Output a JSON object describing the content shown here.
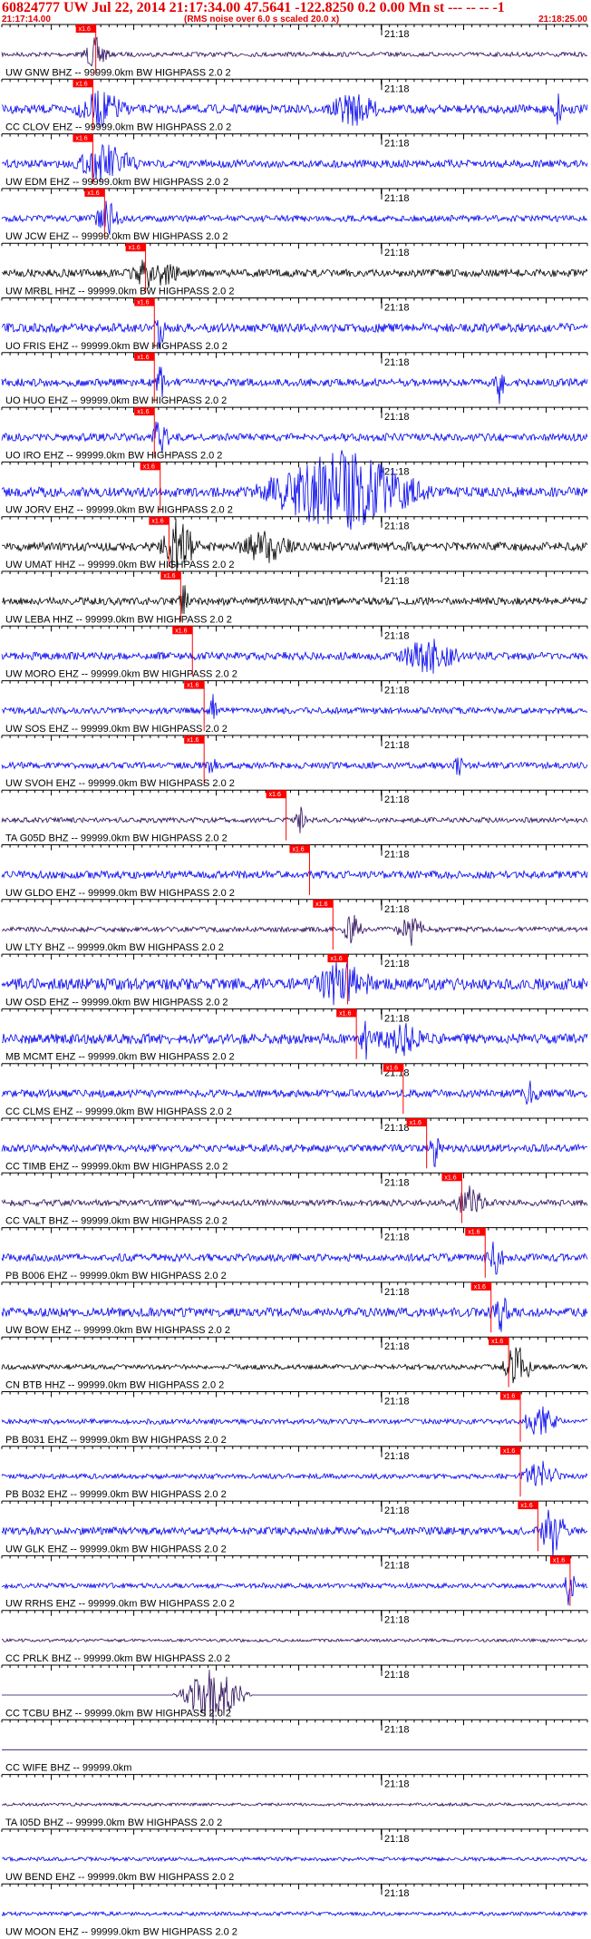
{
  "header": {
    "title": "60824777 UW Jul 22, 2014 21:17:34.00   47.5641 -122.8250  0.2 0.00 Mn st --- -- --  -1",
    "start_time": "21:17:14.00",
    "note": "(RMS noise over 6.0 s scaled 20.0 x)",
    "end_time": "21:18:25.00"
  },
  "minute_label": "21:18",
  "pick_label": "x1.6",
  "colors": {
    "blue": "#0000ee",
    "black": "#000000",
    "purple": "#2a0a5a",
    "pick": "#ff0000",
    "axis": "#000000"
  },
  "traces": [
    {
      "label": "UW GNW BHZ -- 99999.0km BW  HIGHPASS  2.0  2",
      "color": "purple",
      "amp": 0.18,
      "pick": 0.145,
      "bursts": [
        [
          0.16,
          0.025,
          0.9
        ]
      ]
    },
    {
      "label": "CC CLOV EHZ -- 99999.0km BW  HIGHPASS  2.0  2",
      "color": "blue",
      "amp": 0.35,
      "pick": 0.14,
      "bursts": [
        [
          0.17,
          0.05,
          0.9
        ],
        [
          0.6,
          0.05,
          0.8
        ],
        [
          0.95,
          0.01,
          1
        ]
      ]
    },
    {
      "label": "UW EDM EHZ -- 99999.0km BW  HIGHPASS  2.0  2",
      "color": "blue",
      "amp": 0.3,
      "pick": 0.14,
      "bursts": [
        [
          0.18,
          0.06,
          1
        ]
      ]
    },
    {
      "label": "UW JCW EHZ -- 99999.0km BW  HIGHPASS  2.0  2",
      "color": "blue",
      "amp": 0.25,
      "pick": 0.16,
      "bursts": [
        [
          0.18,
          0.03,
          0.9
        ]
      ]
    },
    {
      "label": "UW MRBL HHZ -- 99999.0km BW  HIGHPASS  2.0  2",
      "color": "black",
      "amp": 0.3,
      "pick": 0.23,
      "bursts": [
        [
          0.26,
          0.05,
          0.9
        ]
      ]
    },
    {
      "label": "UO FRIS EHZ -- 99999.0km BW  HIGHPASS  2.0  2",
      "color": "blue",
      "amp": 0.35,
      "pick": 0.245,
      "bursts": [
        [
          0.27,
          0.01,
          1
        ]
      ]
    },
    {
      "label": "UO HUO EHZ -- 99999.0km BW  HIGHPASS  2.0  2",
      "color": "blue",
      "amp": 0.3,
      "pick": 0.245,
      "bursts": [
        [
          0.27,
          0.01,
          1
        ],
        [
          0.85,
          0.01,
          1
        ]
      ]
    },
    {
      "label": "UO IRO EHZ -- 99999.0km BW  HIGHPASS  2.0  2",
      "color": "blue",
      "amp": 0.3,
      "pick": 0.245,
      "bursts": [
        [
          0.27,
          0.02,
          1
        ]
      ]
    },
    {
      "label": "UW JORV EHZ -- 99999.0km BW  HIGHPASS  2.0  2",
      "color": "blue",
      "amp": 0.4,
      "pick": 0.255,
      "bursts": [
        [
          0.58,
          0.16,
          2.2
        ]
      ]
    },
    {
      "label": "UW UMAT HHZ -- 99999.0km BW  HIGHPASS  2.0  2",
      "color": "black",
      "amp": 0.35,
      "pick": 0.27,
      "bursts": [
        [
          0.3,
          0.04,
          1.4
        ],
        [
          0.45,
          0.05,
          0.9
        ]
      ]
    },
    {
      "label": "UW LEBA HHZ -- 99999.0km BW  HIGHPASS  2.0  2",
      "color": "black",
      "amp": 0.3,
      "pick": 0.29,
      "bursts": [
        [
          0.31,
          0.01,
          1
        ]
      ]
    },
    {
      "label": "UW MORO EHZ -- 99999.0km BW  HIGHPASS  2.0  2",
      "color": "blue",
      "amp": 0.3,
      "pick": 0.31,
      "bursts": [
        [
          0.73,
          0.06,
          0.9
        ]
      ]
    },
    {
      "label": "UW SOS EHZ -- 99999.0km BW  HIGHPASS  2.0  2",
      "color": "blue",
      "amp": 0.25,
      "pick": 0.33,
      "bursts": [
        [
          0.36,
          0.01,
          0.8
        ]
      ]
    },
    {
      "label": "UW SVOH EHZ -- 99999.0km BW  HIGHPASS  2.0  2",
      "color": "blue",
      "amp": 0.25,
      "pick": 0.33,
      "bursts": [
        [
          0.36,
          0.01,
          0.8
        ],
        [
          0.78,
          0.01,
          0.7
        ]
      ]
    },
    {
      "label": "TA G05D BHZ -- 99999.0km BW  HIGHPASS  2.0  2",
      "color": "purple",
      "amp": 0.2,
      "pick": 0.47,
      "bursts": [
        [
          0.51,
          0.01,
          0.7
        ]
      ]
    },
    {
      "label": "UW GLDO EHZ -- 99999.0km BW  HIGHPASS  2.0  2",
      "color": "blue",
      "amp": 0.3,
      "pick": 0.51,
      "bursts": []
    },
    {
      "label": "UW LTY BHZ -- 99999.0km BW  HIGHPASS  2.0  2",
      "color": "purple",
      "amp": 0.2,
      "pick": 0.55,
      "bursts": [
        [
          0.6,
          0.02,
          0.9
        ],
        [
          0.7,
          0.03,
          0.8
        ]
      ]
    },
    {
      "label": "UW OSD EHZ -- 99999.0km BW  HIGHPASS  2.0  2",
      "color": "blue",
      "amp": 0.45,
      "pick": 0.575,
      "bursts": [
        [
          0.58,
          0.06,
          1.1
        ]
      ]
    },
    {
      "label": "MB MCMT EHZ -- 99999.0km BW  HIGHPASS  2.0  2",
      "color": "blue",
      "amp": 0.4,
      "pick": 0.59,
      "bursts": [
        [
          0.62,
          0.01,
          1.2
        ],
        [
          0.68,
          0.05,
          0.8
        ]
      ]
    },
    {
      "label": "CC CLMS EHZ -- 99999.0km BW  HIGHPASS  2.0  2",
      "color": "blue",
      "amp": 0.3,
      "pick": 0.67,
      "bursts": [
        [
          0.9,
          0.02,
          0.6
        ]
      ]
    },
    {
      "label": "CC TIMB EHZ -- 99999.0km BW  HIGHPASS  2.0  2",
      "color": "blue",
      "amp": 0.3,
      "pick": 0.71,
      "bursts": [
        [
          0.74,
          0.01,
          1
        ]
      ]
    },
    {
      "label": "CC VALT BHZ -- 99999.0km BW  HIGHPASS  2.0  2",
      "color": "purple",
      "amp": 0.25,
      "pick": 0.77,
      "bursts": [
        [
          0.8,
          0.03,
          0.9
        ]
      ]
    },
    {
      "label": "PB B006 EHZ -- 99999.0km BW  HIGHPASS  2.0  2",
      "color": "blue",
      "amp": 0.3,
      "pick": 0.81,
      "bursts": [
        [
          0.84,
          0.02,
          1
        ]
      ]
    },
    {
      "label": "UW BOW EHZ -- 99999.0km BW  HIGHPASS  2.0  2",
      "color": "blue",
      "amp": 0.35,
      "pick": 0.82,
      "bursts": [
        [
          0.85,
          0.02,
          1
        ]
      ]
    },
    {
      "label": "CN BTB HHZ -- 99999.0km BW  HIGHPASS  2.0  2",
      "color": "black",
      "amp": 0.2,
      "pick": 0.85,
      "bursts": [
        [
          0.88,
          0.03,
          1.3
        ]
      ]
    },
    {
      "label": "PB B031 EHZ -- 99999.0km BW  HIGHPASS  2.0  2",
      "color": "blue",
      "amp": 0.2,
      "pick": 0.87,
      "bursts": [
        [
          0.92,
          0.04,
          0.8
        ]
      ]
    },
    {
      "label": "PB B032 EHZ -- 99999.0km BW  HIGHPASS  2.0  2",
      "color": "blue",
      "amp": 0.2,
      "pick": 0.87,
      "bursts": [
        [
          0.92,
          0.04,
          0.8
        ]
      ]
    },
    {
      "label": "UW GLK EHZ -- 99999.0km BW  HIGHPASS  2.0  2",
      "color": "blue",
      "amp": 0.3,
      "pick": 0.9,
      "bursts": [
        [
          0.94,
          0.03,
          1.4
        ]
      ]
    },
    {
      "label": "UW RRHS EHZ -- 99999.0km BW  HIGHPASS  2.0  2",
      "color": "blue",
      "amp": 0.2,
      "pick": 0.955,
      "bursts": [
        [
          0.97,
          0.01,
          1.3
        ]
      ]
    },
    {
      "label": "CC PRLK BHZ -- 99999.0km BW  HIGHPASS  2.0  2",
      "color": "purple",
      "amp": 0.12,
      "pick": null,
      "bursts": []
    },
    {
      "label": "CC TCBU BHZ -- 99999.0km BW  HIGHPASS  2.0  2",
      "color": "purple",
      "amp": 0.0,
      "pick": null,
      "bursts": [
        [
          0.36,
          0.07,
          1.6
        ]
      ]
    },
    {
      "label": "CC WIFE BHZ -- 99999.0km",
      "color": "purple",
      "amp": 0.0,
      "pick": null,
      "bursts": []
    },
    {
      "label": "TA I05D BHZ -- 99999.0km BW  HIGHPASS  2.0  2",
      "color": "purple",
      "amp": 0.12,
      "pick": null,
      "bursts": []
    },
    {
      "label": "UW BEND EHZ -- 99999.0km BW  HIGHPASS  2.0  2",
      "color": "blue",
      "amp": 0.15,
      "pick": null,
      "bursts": []
    },
    {
      "label": "UW MOON EHZ -- 99999.0km BW  HIGHPASS  2.0  2",
      "color": "blue",
      "amp": 0.15,
      "pick": null,
      "bursts": []
    }
  ]
}
